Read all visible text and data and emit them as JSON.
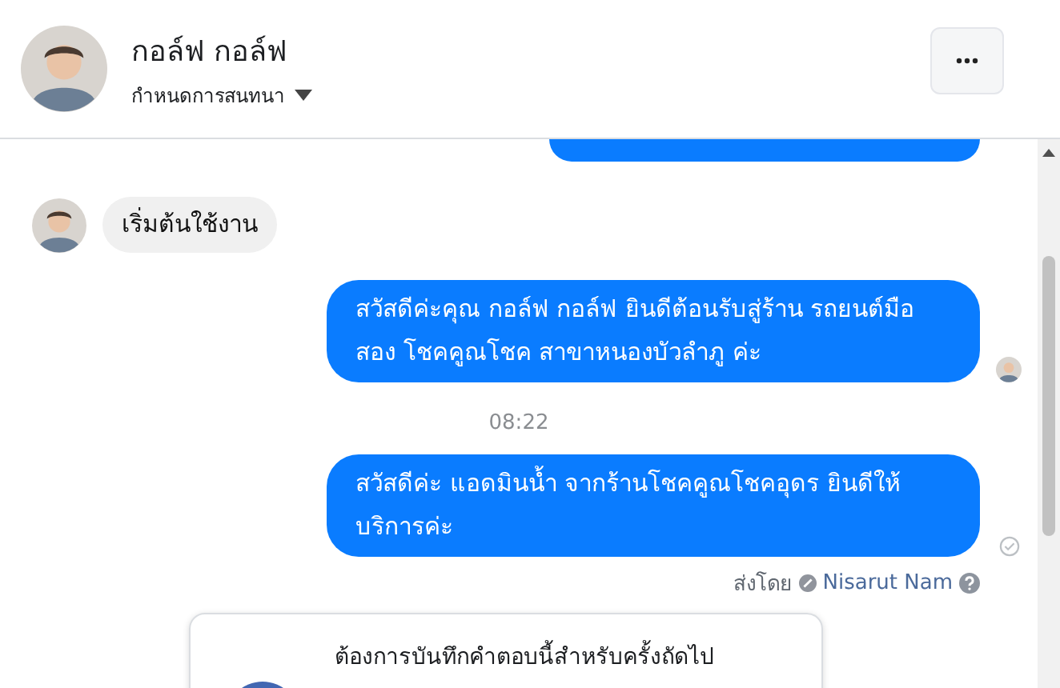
{
  "header": {
    "name": "กอล์ฟ กอล์ฟ",
    "subtitle": "กำหนดการสนทนา"
  },
  "messages": [
    {
      "kind": "partial"
    },
    {
      "kind": "incoming",
      "text": "เริ่มต้นใช้งาน"
    },
    {
      "kind": "outgoing",
      "text": "สวัสดีค่ะคุณ กอล์ฟ กอล์ฟ ยินดีต้อนรับสู่ร้าน รถยนต์มือสอง โชคคูณโชค สาขาหนองบัวลำภู ค่ะ",
      "seen": true
    },
    {
      "kind": "time",
      "text": "08:22"
    },
    {
      "kind": "outgoing",
      "text": "สวัสดีค่ะ แอดมินน้ำ จากร้านโชคคูณโชคอุดร ยินดีให้บริการค่ะ",
      "seen": false
    }
  ],
  "sent_by": {
    "label": "ส่งโดย",
    "name": "Nisarut Nam"
  },
  "prompt": {
    "text": "ต้องการบันทึกคำตอบนี้สำหรับครั้งถัดไป"
  }
}
